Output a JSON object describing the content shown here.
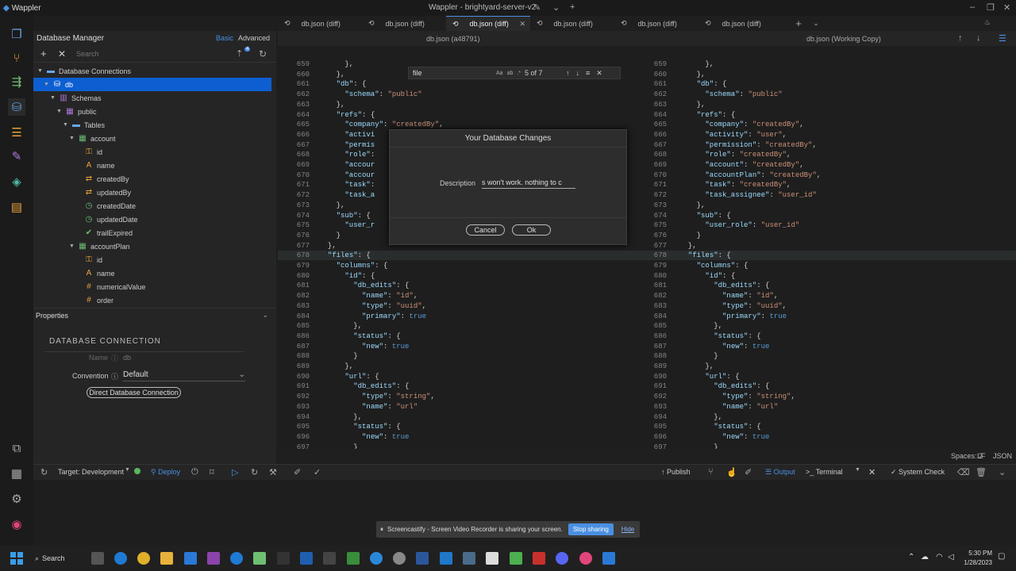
{
  "titlebar": {
    "app": "Wappler",
    "title": "Wappler - brightyard-server-v2"
  },
  "tabs": [
    {
      "label": "db.json (diff)",
      "active": false
    },
    {
      "label": "db.json (diff)",
      "active": false
    },
    {
      "label": "db.json (diff)",
      "active": true
    },
    {
      "label": "db.json (diff)",
      "active": false
    },
    {
      "label": "db.json (diff)",
      "active": false
    },
    {
      "label": "db.json (diff)",
      "active": false
    }
  ],
  "db_manager": {
    "title": "Database Manager",
    "basic": "Basic",
    "advanced": "Advanced",
    "search_placeholder": "Search",
    "filter_badge": "4"
  },
  "tree": [
    {
      "label": "Database Connections",
      "indent": 0,
      "icon": "folder",
      "caret": "▼"
    },
    {
      "label": "db",
      "indent": 1,
      "icon": "database",
      "caret": "▼",
      "selected": true
    },
    {
      "label": "Schemas",
      "indent": 2,
      "icon": "schemas",
      "caret": "▼"
    },
    {
      "label": "public",
      "indent": 3,
      "icon": "schema",
      "caret": "▼"
    },
    {
      "label": "Tables",
      "indent": 4,
      "icon": "folder",
      "caret": "▼"
    },
    {
      "label": "account",
      "indent": 5,
      "icon": "table",
      "caret": "▼"
    },
    {
      "label": "id",
      "indent": 6,
      "icon": "key"
    },
    {
      "label": "name",
      "indent": 6,
      "icon": "text"
    },
    {
      "label": "createdBy",
      "indent": 6,
      "icon": "ref"
    },
    {
      "label": "updatedBy",
      "indent": 6,
      "icon": "ref"
    },
    {
      "label": "createdDate",
      "indent": 6,
      "icon": "date"
    },
    {
      "label": "updatedDate",
      "indent": 6,
      "icon": "date"
    },
    {
      "label": "trailExpired",
      "indent": 6,
      "icon": "check"
    },
    {
      "label": "accountPlan",
      "indent": 5,
      "icon": "table",
      "caret": "▼"
    },
    {
      "label": "id",
      "indent": 6,
      "icon": "key"
    },
    {
      "label": "name",
      "indent": 6,
      "icon": "text"
    },
    {
      "label": "numericalValue",
      "indent": 6,
      "icon": "number"
    },
    {
      "label": "order",
      "indent": 6,
      "icon": "number"
    }
  ],
  "properties": {
    "title": "Properties",
    "section": "DATABASE CONNECTION",
    "name_label": "Name",
    "name_value": "db",
    "convention_label": "Convention",
    "convention_value": "Default",
    "direct_button": "Direct Database Connection"
  },
  "editor": {
    "left_title": "db.json (a48791)",
    "right_title": "db.json (Working Copy)",
    "find": {
      "query": "file",
      "count": "5 of 7"
    },
    "left_lines": [
      [
        "659",
        "      },"
      ],
      [
        "660",
        "    },"
      ],
      [
        "661",
        "    \"db\": {"
      ],
      [
        "662",
        "      \"schema\": \"public\""
      ],
      [
        "663",
        "    },"
      ],
      [
        "664",
        "    \"refs\": {"
      ],
      [
        "665",
        "      \"company\": \"createdBy\","
      ],
      [
        "666",
        "      \"activi"
      ],
      [
        "667",
        "      \"permis"
      ],
      [
        "668",
        "      \"role\":"
      ],
      [
        "669",
        "      \"accour"
      ],
      [
        "670",
        "      \"accour"
      ],
      [
        "671",
        "      \"task\":"
      ],
      [
        "672",
        "      \"task_a"
      ],
      [
        "673",
        "    },"
      ],
      [
        "674",
        "    \"sub\": {"
      ],
      [
        "675",
        "      \"user_r"
      ],
      [
        "676",
        "    }"
      ],
      [
        "677",
        "  },"
      ],
      [
        "678",
        "  \"files\": {"
      ],
      [
        "679",
        "    \"columns\": {"
      ],
      [
        "680",
        "      \"id\": {"
      ],
      [
        "681",
        "        \"db_edits\": {"
      ],
      [
        "682",
        "          \"name\": \"id\","
      ],
      [
        "683",
        "          \"type\": \"uuid\","
      ],
      [
        "684",
        "          \"primary\": true"
      ],
      [
        "685",
        "        },"
      ],
      [
        "686",
        "        \"status\": {"
      ],
      [
        "687",
        "          \"new\": true"
      ],
      [
        "688",
        "        }"
      ],
      [
        "689",
        "      },"
      ],
      [
        "690",
        "      \"url\": {"
      ],
      [
        "691",
        "        \"db_edits\": {"
      ],
      [
        "692",
        "          \"type\": \"string\","
      ],
      [
        "693",
        "          \"name\": \"url\""
      ],
      [
        "694",
        "        },"
      ],
      [
        "695",
        "        \"status\": {"
      ],
      [
        "696",
        "          \"new\": true"
      ],
      [
        "697",
        "        }"
      ]
    ],
    "right_lines": [
      [
        "659",
        "      },"
      ],
      [
        "660",
        "    },"
      ],
      [
        "661",
        "    \"db\": {"
      ],
      [
        "662",
        "      \"schema\": \"public\""
      ],
      [
        "663",
        "    },"
      ],
      [
        "664",
        "    \"refs\": {"
      ],
      [
        "665",
        "      \"company\": \"createdBy\","
      ],
      [
        "666",
        "      \"activity\": \"user\","
      ],
      [
        "667",
        "      \"permission\": \"createdBy\","
      ],
      [
        "668",
        "      \"role\": \"createdBy\","
      ],
      [
        "669",
        "      \"account\": \"createdBy\","
      ],
      [
        "670",
        "      \"accountPlan\": \"createdBy\","
      ],
      [
        "671",
        "      \"task\": \"createdBy\","
      ],
      [
        "672",
        "      \"task_assignee\": \"user_id\""
      ],
      [
        "673",
        "    },"
      ],
      [
        "674",
        "    \"sub\": {"
      ],
      [
        "675",
        "      \"user_role\": \"user_id\""
      ],
      [
        "676",
        "    }"
      ],
      [
        "677",
        "  },"
      ],
      [
        "678",
        "  \"files\": {"
      ],
      [
        "679",
        "    \"columns\": {"
      ],
      [
        "680",
        "      \"id\": {"
      ],
      [
        "681",
        "        \"db_edits\": {"
      ],
      [
        "682",
        "          \"name\": \"id\","
      ],
      [
        "683",
        "          \"type\": \"uuid\","
      ],
      [
        "684",
        "          \"primary\": true"
      ],
      [
        "685",
        "        },"
      ],
      [
        "686",
        "        \"status\": {"
      ],
      [
        "687",
        "          \"new\": true"
      ],
      [
        "688",
        "        }"
      ],
      [
        "689",
        "      },"
      ],
      [
        "690",
        "      \"url\": {"
      ],
      [
        "691",
        "        \"db_edits\": {"
      ],
      [
        "692",
        "          \"type\": \"string\","
      ],
      [
        "693",
        "          \"name\": \"url\""
      ],
      [
        "694",
        "        },"
      ],
      [
        "695",
        "        \"status\": {"
      ],
      [
        "696",
        "          \"new\": true"
      ],
      [
        "697",
        "        }"
      ]
    ]
  },
  "dialog": {
    "title": "Your Database Changes",
    "description_label": "Description",
    "description_value": "s won't work. nothing to c",
    "cancel": "Cancel",
    "ok": "Ok"
  },
  "statusbar": {
    "spaces": "Spaces: 2",
    "eol": "LF",
    "lang": "JSON"
  },
  "bottombar": {
    "target": "Target: Development",
    "deploy": "Deploy",
    "publish": "Publish",
    "output": "Output",
    "terminal": "Terminal",
    "system_check": "System Check"
  },
  "sharebar": {
    "text": "Screencastify - Screen Video Recorder is sharing your screen.",
    "stop": "Stop sharing",
    "hide": "Hide"
  },
  "taskbar": {
    "search": "Search",
    "time": "5:30 PM",
    "date": "1/28/2023"
  }
}
